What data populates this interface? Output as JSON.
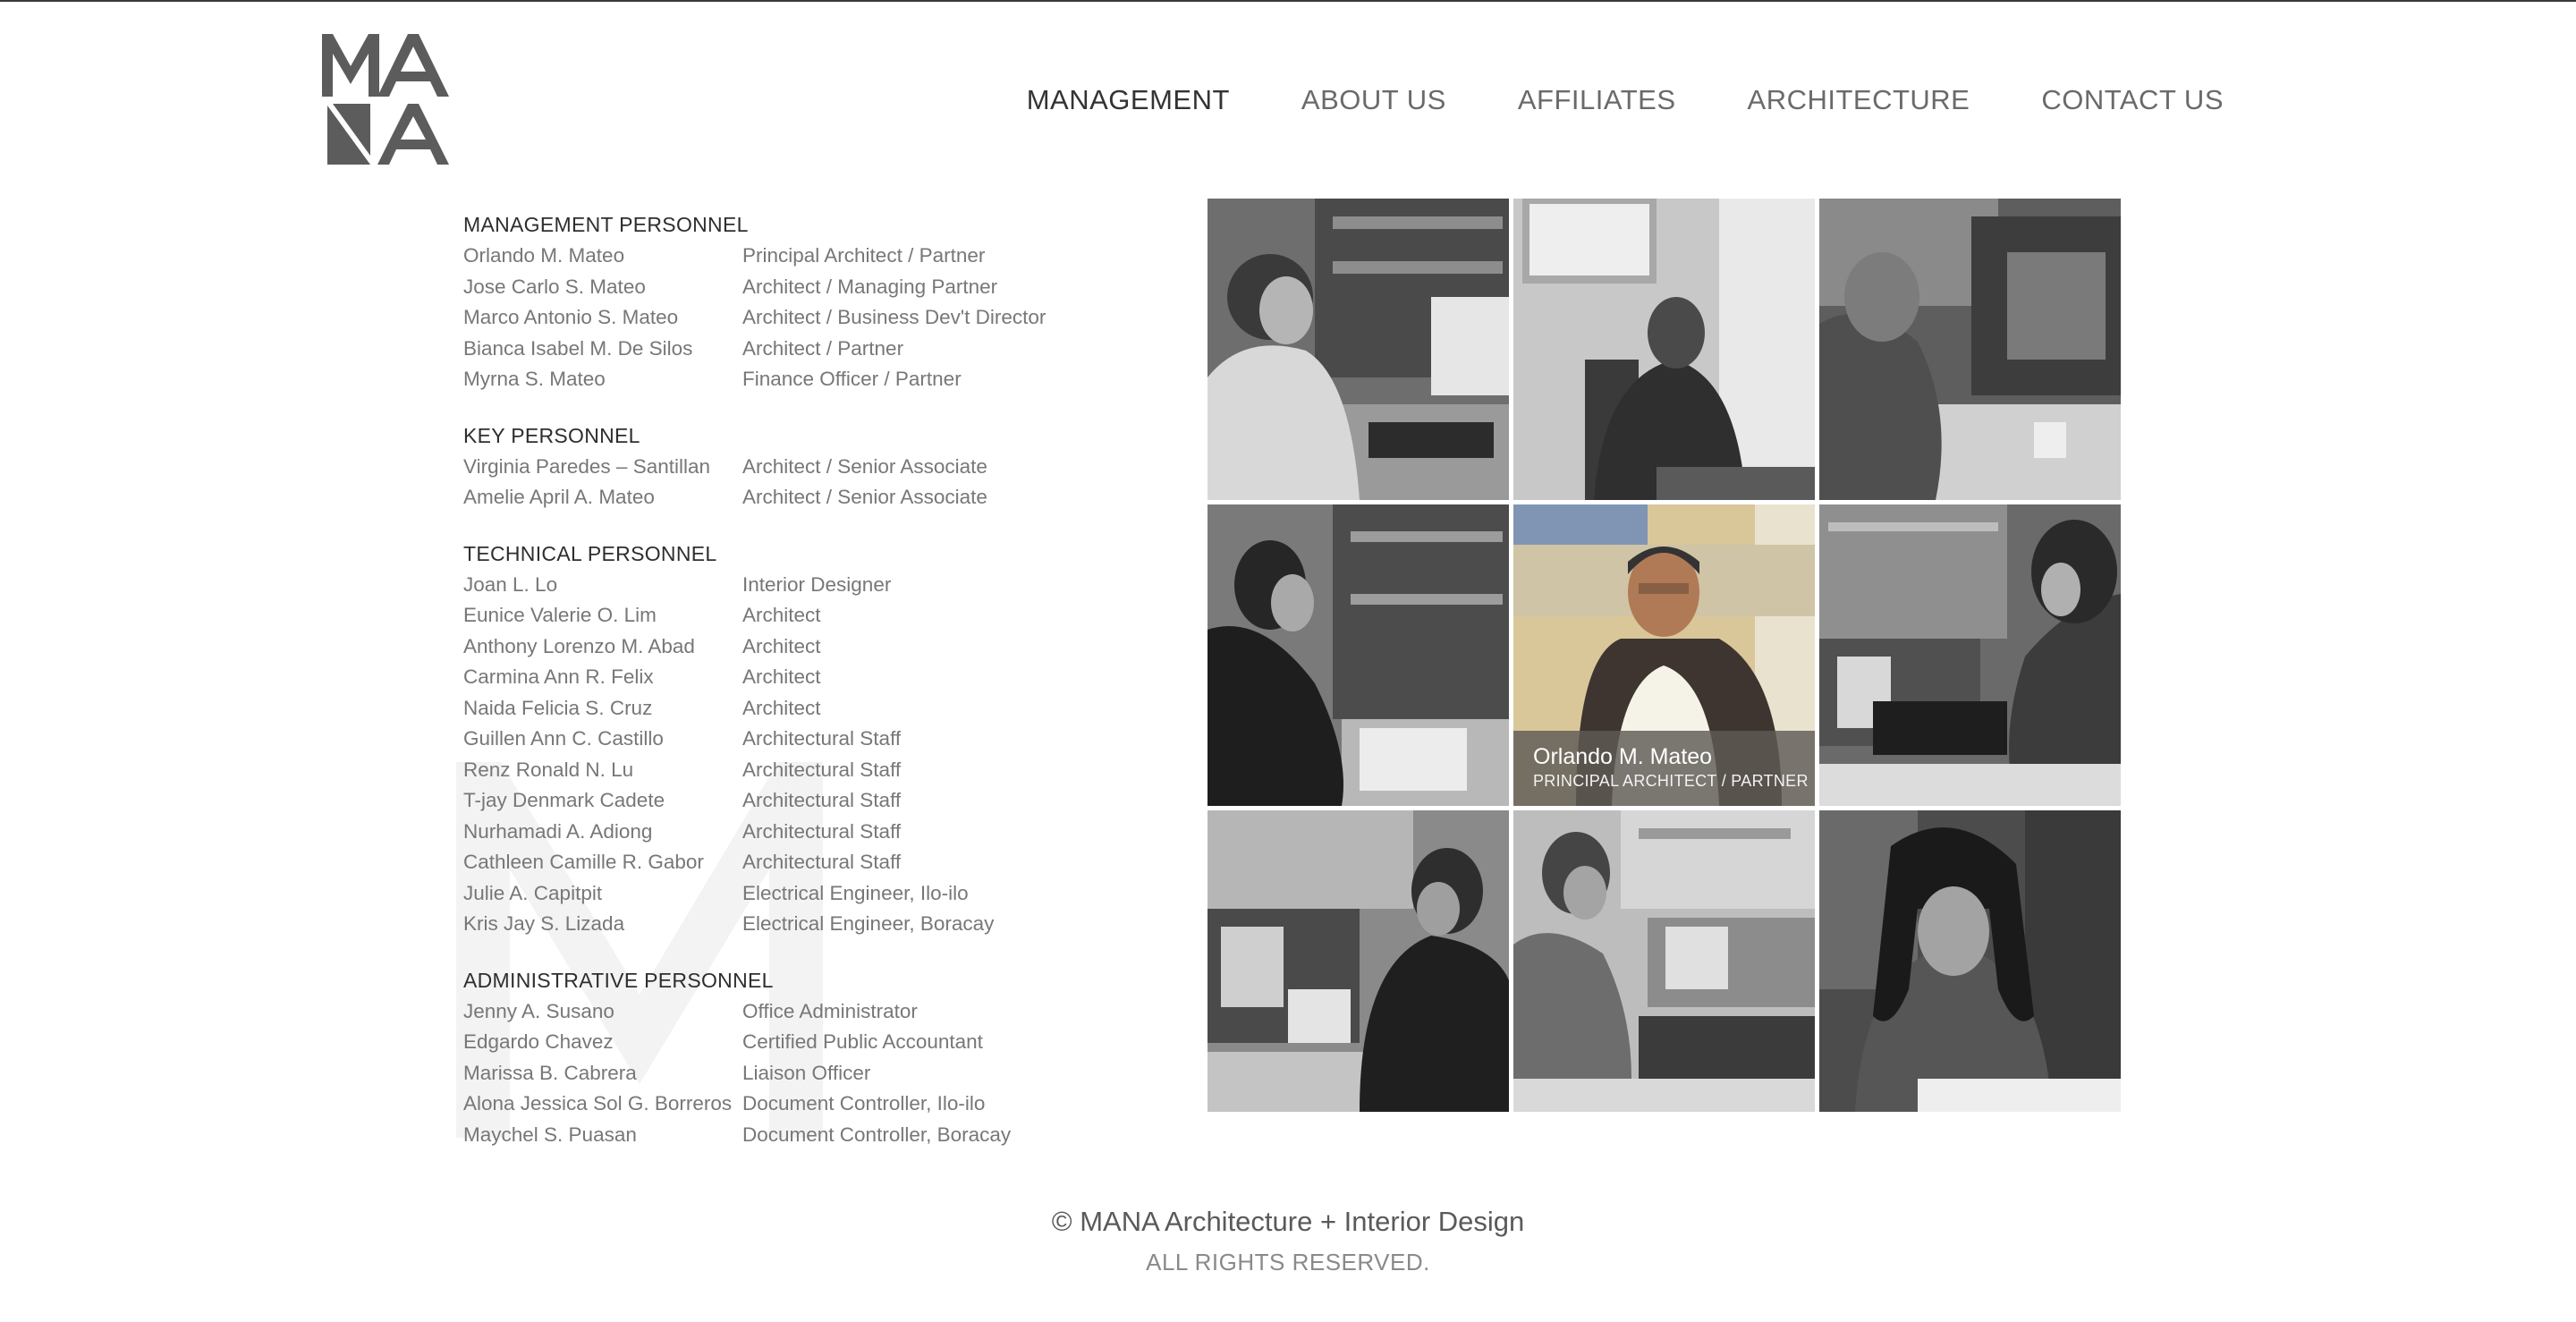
{
  "logo": {
    "text": "MANA"
  },
  "nav": [
    {
      "label": "MANAGEMENT",
      "active": true
    },
    {
      "label": "ABOUT US"
    },
    {
      "label": "AFFILIATES"
    },
    {
      "label": "ARCHITECTURE"
    },
    {
      "label": "CONTACT US"
    }
  ],
  "sections": [
    {
      "title": "MANAGEMENT PERSONNEL",
      "rows": [
        {
          "name": "Orlando M. Mateo",
          "role": "Principal Architect / Partner"
        },
        {
          "name": "Jose Carlo S. Mateo",
          "role": "Architect / Managing Partner"
        },
        {
          "name": "Marco Antonio S. Mateo",
          "role": "Architect / Business Dev't Director"
        },
        {
          "name": "Bianca Isabel M. De Silos",
          "role": "Architect / Partner"
        },
        {
          "name": "Myrna S. Mateo",
          "role": "Finance Officer / Partner"
        }
      ]
    },
    {
      "title": "KEY PERSONNEL",
      "rows": [
        {
          "name": "Virginia Paredes – Santillan",
          "role": "Architect / Senior Associate"
        },
        {
          "name": "Amelie April A. Mateo",
          "role": "Architect / Senior Associate"
        }
      ]
    },
    {
      "title": "TECHNICAL PERSONNEL",
      "rows": [
        {
          "name": "Joan L. Lo",
          "role": "Interior Designer"
        },
        {
          "name": "Eunice Valerie O. Lim",
          "role": "Architect"
        },
        {
          "name": "Anthony Lorenzo M. Abad",
          "role": "Architect"
        },
        {
          "name": "Carmina Ann R. Felix",
          "role": "Architect"
        },
        {
          "name": "Naida Felicia S. Cruz",
          "role": "Architect"
        },
        {
          "name": "Guillen Ann C. Castillo",
          "role": "Architectural Staff"
        },
        {
          "name": "Renz Ronald N. Lu",
          "role": "Architectural Staff"
        },
        {
          "name": "T-jay Denmark Cadete",
          "role": "Architectural Staff"
        },
        {
          "name": "Nurhamadi A. Adiong",
          "role": "Architectural Staff"
        },
        {
          "name": "Cathleen Camille R. Gabor",
          "role": "Architectural Staff"
        },
        {
          "name": "Julie A. Capitpit",
          "role": "Electrical Engineer, Ilo-ilo"
        },
        {
          "name": "Kris Jay S. Lizada",
          "role": "Electrical Engineer, Boracay"
        }
      ]
    },
    {
      "title": "ADMINISTRATIVE PERSONNEL",
      "rows": [
        {
          "name": "Jenny A. Susano",
          "role": "Office Administrator"
        },
        {
          "name": "Edgardo Chavez",
          "role": "Certified Public Accountant"
        },
        {
          "name": "Marissa B. Cabrera",
          "role": "Liaison Officer"
        },
        {
          "name": "Alona Jessica Sol G. Borreros",
          "role": "Document Controller, Ilo-ilo"
        },
        {
          "name": "Maychel S. Puasan",
          "role": "Document Controller, Boracay"
        }
      ]
    }
  ],
  "photo_caption": {
    "name": "Orlando M. Mateo",
    "role": "PRINCIPAL ARCHITECT / PARTNER"
  },
  "footer": {
    "copyright": "© MANA Architecture + Interior Design",
    "rights": "ALL RIGHTS RESERVED."
  }
}
